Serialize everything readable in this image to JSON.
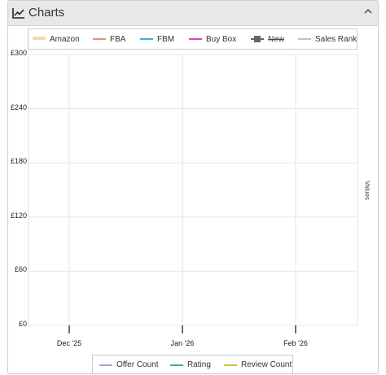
{
  "panel": {
    "title": "Charts",
    "icon": "line-chart-icon",
    "collapse_icon": "chevron-up-icon"
  },
  "legend_top": [
    {
      "name": "Amazon",
      "color": "#f5d9a8",
      "style": "band",
      "active": true
    },
    {
      "name": "FBA",
      "color": "#f08a7a",
      "style": "line",
      "active": true
    },
    {
      "name": "FBM",
      "color": "#3bb3e0",
      "style": "line",
      "active": true
    },
    {
      "name": "Buy Box",
      "color": "#e040c8",
      "style": "line",
      "active": true
    },
    {
      "name": "New",
      "color": "#666666",
      "style": "marker",
      "active": false
    },
    {
      "name": "Sales Rank",
      "color": "#a8d8a0",
      "style": "line",
      "active": true
    }
  ],
  "legend_bottom": [
    {
      "name": "Offer Count",
      "color": "#a99be0"
    },
    {
      "name": "Rating",
      "color": "#2bb5a5"
    },
    {
      "name": "Review Count",
      "color": "#c8c33a"
    }
  ],
  "chart_data": {
    "type": "line",
    "title": "",
    "xlabel": "",
    "ylabel": "",
    "y2label": "Values",
    "y_ticks": [
      "£0",
      "£60",
      "£120",
      "£180",
      "£240",
      "£300"
    ],
    "ylim": [
      0,
      300
    ],
    "x_ticks": [
      "Dec '25",
      "Jan '26",
      "Feb '26"
    ],
    "grid": true,
    "legend_position": "top",
    "series": []
  }
}
